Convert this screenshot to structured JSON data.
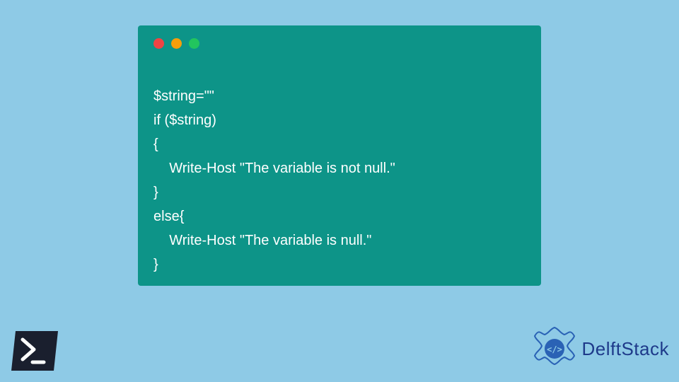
{
  "code": {
    "lines": [
      "$string=\"\"",
      "if ($string)",
      "{",
      "    Write-Host \"The variable is not null.\"",
      "}",
      "else{",
      "    Write-Host \"The variable is null.\"",
      "}"
    ]
  },
  "brand": {
    "name": "DelftStack"
  },
  "colors": {
    "background": "#8ecae6",
    "window": "#0d9488",
    "brand": "#1e3a8a"
  }
}
